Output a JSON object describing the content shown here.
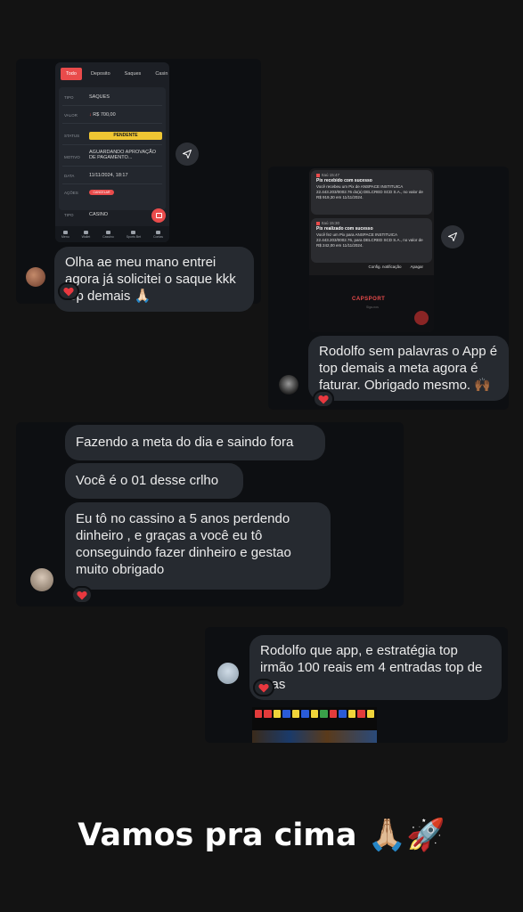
{
  "story": {
    "footer_text": "Vamos pra cima 🙏🏼🚀"
  },
  "card1": {
    "app_tabs": [
      "Todo",
      "Deposito",
      "Saques",
      "Casin"
    ],
    "rows": [
      {
        "label": "TIPO",
        "value": "SAQUES"
      },
      {
        "label": "VALOR",
        "value": "R$ 700,00"
      },
      {
        "label": "STATUS",
        "value": "PENDENTE"
      },
      {
        "label": "MOTIVO",
        "value": "AGUARDANDO APROVAÇÃO DE PAGAMENTO..."
      },
      {
        "label": "DATA",
        "value": "11/11/2024, 18:17"
      },
      {
        "label": "AÇÕES",
        "value": "CANCELAR"
      }
    ],
    "second_row": {
      "label": "TIPO",
      "value": "CASINO"
    },
    "nav": [
      "Menu",
      "Wallet",
      "Cassino",
      "Sports Bet",
      "Contas"
    ],
    "message": "Olha ae meu mano entrei agora já solicitei o saque kkk top demais 🙏🏻"
  },
  "card2": {
    "notifications": [
      {
        "app": "Itaú",
        "time": "15:47",
        "title": "Pix recebido com sucesso",
        "body": "Você recebeu um Pix de ANSPACE INSTITUICA 22.443.203/0002.76 do(a) DELCRED SCD S.A., no valor de R$ 919,30 em 11/11/2024."
      },
      {
        "app": "Itaú",
        "time": "15:30",
        "title": "Pix realizado com sucesso",
        "body": "Você fez um Pix para ANSPACE INSTITUICA 22.443.203/0002.76, para DELCRED SCD S.A., no valor de R$ 242,00 em 11/11/2024."
      }
    ],
    "notif_actions": [
      "Config. notificação",
      "Apagar"
    ],
    "app_logo": "CAPSPORT",
    "app_sub": "Siga-nos",
    "message": "Rodolfo sem palavras o App é top demais a meta agora é faturar. Obrigado mesmo. 🙌🏾"
  },
  "card3": {
    "messages": [
      "Fazendo a meta do dia e saindo fora",
      "Você é o 01 desse crlho",
      "Eu tô no cassino a 5 anos perdendo dinheiro , e graças a você eu tô conseguindo fazer dinheiro e gestao muito obrigado"
    ]
  },
  "card4": {
    "message": "Rodolfo que app, e estratégia top irmão 100 reais em 4 entradas top de mas",
    "roulette_colors": [
      "#e23b3b",
      "#e23b3b",
      "#f0d43a",
      "#2a5bd7",
      "#f0d43a",
      "#2a5bd7",
      "#f0d43a",
      "#3aa14a",
      "#e23b3b",
      "#2a5bd7",
      "#f0d43a",
      "#e23b3b",
      "#f0d43a"
    ]
  },
  "colors": {
    "accent_red": "#e94b4b",
    "pending_yellow": "#efc633",
    "heart": "#e8383f"
  }
}
